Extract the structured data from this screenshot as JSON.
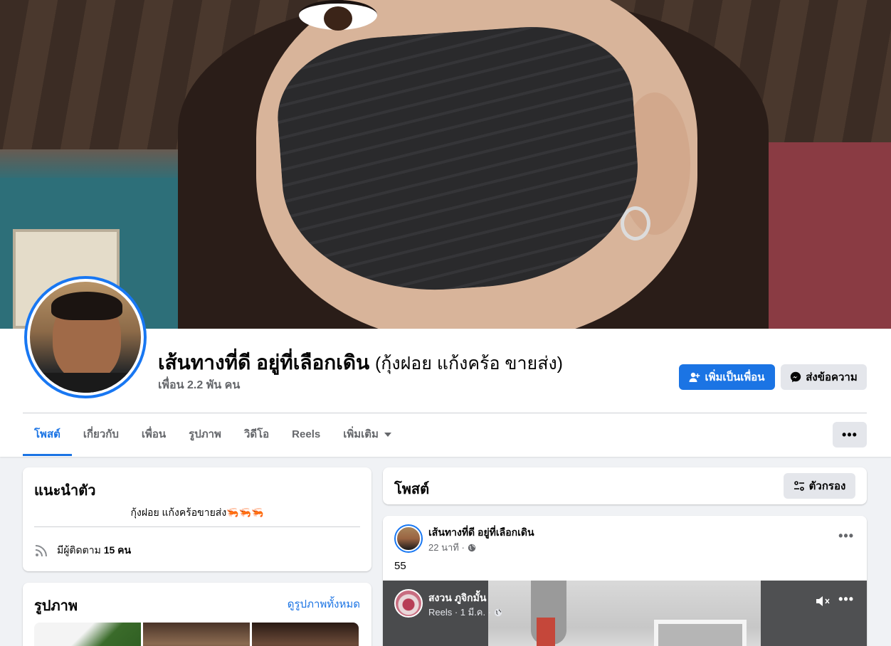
{
  "profile": {
    "name": "เส้นทางที่ดี อยู่ที่เลือกเดิน",
    "alt_name": "(กุ้งฝอย แก้งคร้อ ขายส่ง)",
    "friends": "เพื่อน 2.2 พัน คน",
    "add_friend_label": "เพิ่มเป็นเพื่อน",
    "message_label": "ส่งข้อความ",
    "more_label": "•••"
  },
  "tabs": [
    {
      "label": "โพสต์",
      "active": true
    },
    {
      "label": "เกี่ยวกับ"
    },
    {
      "label": "เพื่อน"
    },
    {
      "label": "รูปภาพ"
    },
    {
      "label": "วิดีโอ"
    },
    {
      "label": "Reels"
    },
    {
      "label": "เพิ่มเติม"
    }
  ],
  "intro": {
    "title": "แนะนำตัว",
    "bio": "กุ้งฝอย แก้งคร้อขายส่ง🦐🦐🦐",
    "followers_prefix": "มีผู้ติดตาม",
    "followers_count": "15 คน"
  },
  "photos": {
    "title": "รูปภาพ",
    "see_all": "ดูรูปภาพทั้งหมด"
  },
  "posts": {
    "title": "โพสต์",
    "filter_label": "ตัวกรอง"
  },
  "post": {
    "author": "เส้นทางที่ดี อยู่ที่เลือกเดิน",
    "time": "22 นาที ·",
    "text": "55",
    "more_label": "•••",
    "shared": {
      "author": "สงวน ภูจิกมั้น",
      "meta": "Reels · 1 มี.ค. ·",
      "more_label": "•••"
    }
  },
  "colors": {
    "accent": "#1b74e4",
    "background": "#f0f2f5",
    "secondary_text": "#65676b"
  }
}
